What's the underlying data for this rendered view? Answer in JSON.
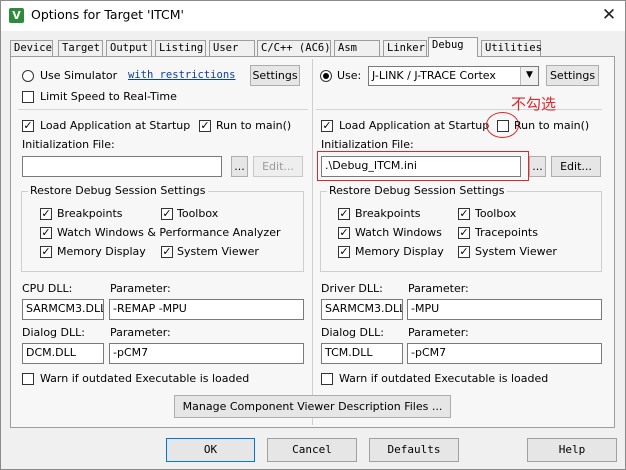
{
  "window": {
    "title": "Options for Target 'ITCM'",
    "close_icon": "close-icon"
  },
  "tabs": [
    "Device",
    "Target",
    "Output",
    "Listing",
    "User",
    "C/C++ (AC6)",
    "Asm",
    "Linker",
    "Debug",
    "Utilities"
  ],
  "active_tab": "Debug",
  "left": {
    "use_simulator": "Use Simulator",
    "with_restrictions": "with restrictions",
    "settings": "Settings",
    "limit_speed": "Limit Speed to Real-Time",
    "load_app": "Load Application at Startup",
    "run_to_main": "Run to main()",
    "init_file_label": "Initialization File:",
    "init_file_value": "",
    "browse": "...",
    "edit": "Edit...",
    "restore_title": "Restore Debug Session Settings",
    "breakpoints": "Breakpoints",
    "toolbox": "Toolbox",
    "watch": "Watch Windows & Performance Analyzer",
    "memory": "Memory Display",
    "system_viewer": "System Viewer",
    "cpu_dll_label": "CPU DLL:",
    "cpu_param_label": "Parameter:",
    "cpu_dll": "SARMCM3.DLL",
    "cpu_param": "-REMAP -MPU",
    "dialog_dll_label": "Dialog DLL:",
    "dialog_param_label": "Parameter:",
    "dialog_dll": "DCM.DLL",
    "dialog_param": "-pCM7",
    "warn": "Warn if outdated Executable is loaded"
  },
  "right": {
    "use": "Use:",
    "debugger": "J-LINK / J-TRACE Cortex",
    "settings": "Settings",
    "load_app": "Load Application at Startup",
    "run_to_main": "Run to main()",
    "annotation": "不勾选",
    "init_file_label": "Initialization File:",
    "init_file_value": ".\\Debug_ITCM.ini",
    "browse": "...",
    "edit": "Edit...",
    "restore_title": "Restore Debug Session Settings",
    "breakpoints": "Breakpoints",
    "toolbox": "Toolbox",
    "watch": "Watch Windows",
    "tracepoints": "Tracepoints",
    "memory": "Memory Display",
    "system_viewer": "System Viewer",
    "driver_dll_label": "Driver DLL:",
    "driver_param_label": "Parameter:",
    "driver_dll": "SARMCM3.DLL",
    "driver_param": "-MPU",
    "dialog_dll_label": "Dialog DLL:",
    "dialog_param_label": "Parameter:",
    "dialog_dll": "TCM.DLL",
    "dialog_param": "-pCM7",
    "warn": "Warn if outdated Executable is loaded"
  },
  "manage_button": "Manage Component Viewer Description Files ...",
  "footer": {
    "ok": "OK",
    "cancel": "Cancel",
    "defaults": "Defaults",
    "help": "Help"
  },
  "colors": {
    "annotation": "#e0262b",
    "title_icon": "#2e8b3b",
    "link": "#0b3ea8"
  }
}
